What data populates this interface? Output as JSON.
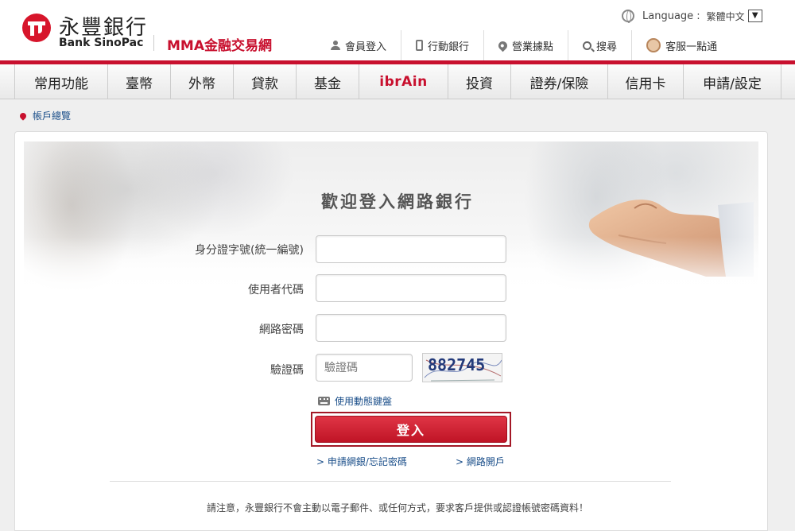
{
  "header": {
    "logo_zh": "永豐銀行",
    "logo_en": "Bank SinoPac",
    "site_title": "MMA金融交易網",
    "language_label": "Language :",
    "language_value": "繁體中文",
    "language_dropdown": "▼",
    "top_links": [
      {
        "label": "會員登入",
        "icon": "person-icon"
      },
      {
        "label": "行動銀行",
        "icon": "phone-icon"
      },
      {
        "label": "營業據點",
        "icon": "location-pin-icon"
      },
      {
        "label": "搜尋",
        "icon": "search-icon"
      },
      {
        "label": "客服一點通",
        "icon": "customer-service-icon"
      }
    ]
  },
  "main_nav": [
    "常用功能",
    "臺幣",
    "外幣",
    "貸款",
    "基金",
    "ibrAin",
    "投資",
    "證券/保險",
    "信用卡",
    "申請/設定"
  ],
  "breadcrumb": "帳戶總覽",
  "login": {
    "welcome": "歡迎登入網路銀行",
    "id_label": "身分證字號(統一編號)",
    "id_value": "",
    "user_label": "使用者代碼",
    "user_value": "",
    "password_label": "網路密碼",
    "password_value": "",
    "captcha_label": "驗證碼",
    "captcha_placeholder": "驗證碼",
    "captcha_text": "882745",
    "virtual_keyboard": "使用動態鍵盤",
    "login_button": "登入",
    "apply_link": "> 申請網銀/忘記密碼",
    "open_link": "> 網路開戶"
  },
  "notice": "請注意，永豐銀行不會主動以電子郵件、或任何方式，要求客戶提供或認證帳號密碼資料！",
  "colors": {
    "brand_red": "#c8102e",
    "link_blue": "#1b4f8a"
  }
}
